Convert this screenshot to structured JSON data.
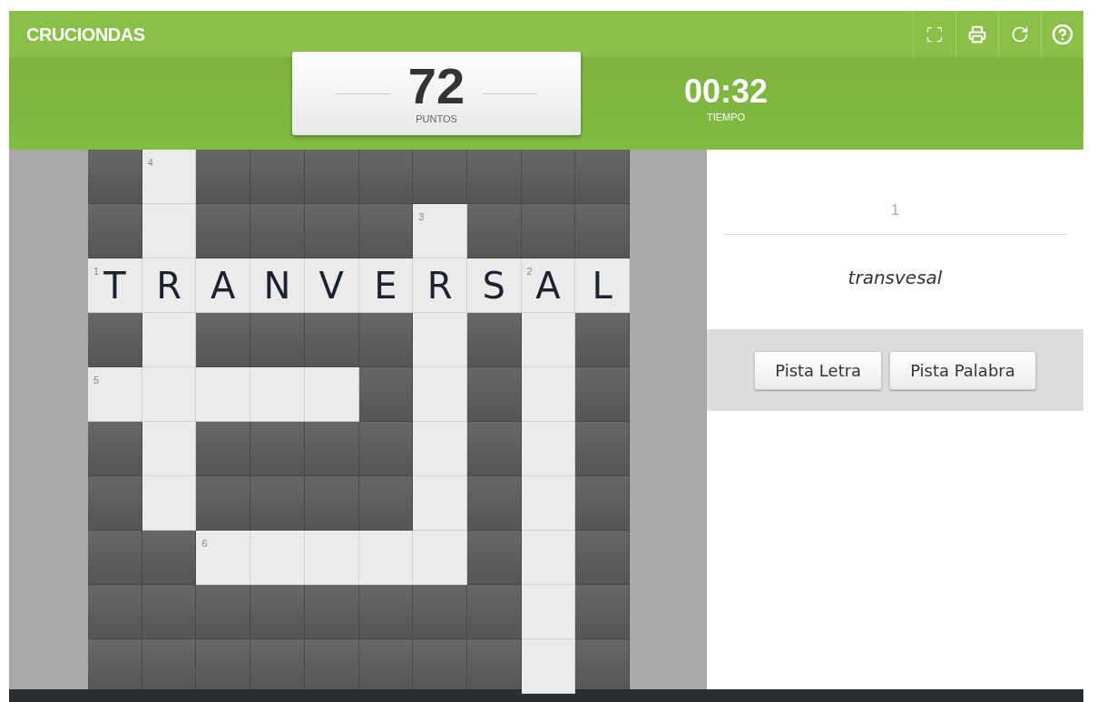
{
  "header": {
    "title": "CRUCIONDAS",
    "tools": [
      {
        "kind": "fullscreen"
      },
      {
        "kind": "print"
      },
      {
        "kind": "restart"
      },
      {
        "kind": "help"
      }
    ]
  },
  "score": {
    "value": "72",
    "label": "PUNTOS"
  },
  "timer": {
    "value": "00:32",
    "label": "TIEMPO"
  },
  "grid": [
    [
      {
        "kind": "block"
      },
      {
        "kind": "open",
        "number": "4"
      },
      {
        "kind": "block"
      },
      {
        "kind": "block"
      },
      {
        "kind": "block"
      },
      {
        "kind": "block"
      },
      {
        "kind": "block"
      },
      {
        "kind": "block"
      },
      {
        "kind": "block"
      },
      {
        "kind": "block"
      }
    ],
    [
      {
        "kind": "block"
      },
      {
        "kind": "open"
      },
      {
        "kind": "block"
      },
      {
        "kind": "block"
      },
      {
        "kind": "block"
      },
      {
        "kind": "block"
      },
      {
        "kind": "open",
        "number": "3"
      },
      {
        "kind": "block"
      },
      {
        "kind": "block"
      },
      {
        "kind": "block"
      }
    ],
    [
      {
        "kind": "open",
        "number": "1",
        "letter": "T"
      },
      {
        "kind": "open",
        "letter": "R"
      },
      {
        "kind": "open",
        "letter": "A"
      },
      {
        "kind": "open",
        "letter": "N"
      },
      {
        "kind": "open",
        "letter": "V"
      },
      {
        "kind": "open",
        "letter": "E"
      },
      {
        "kind": "open",
        "letter": "R"
      },
      {
        "kind": "open",
        "letter": "S"
      },
      {
        "kind": "open",
        "number": "2",
        "letter": "A"
      },
      {
        "kind": "open",
        "letter": "L"
      }
    ],
    [
      {
        "kind": "block"
      },
      {
        "kind": "open"
      },
      {
        "kind": "block"
      },
      {
        "kind": "block"
      },
      {
        "kind": "block"
      },
      {
        "kind": "block"
      },
      {
        "kind": "open"
      },
      {
        "kind": "block"
      },
      {
        "kind": "open"
      },
      {
        "kind": "block"
      }
    ],
    [
      {
        "kind": "open",
        "number": "5"
      },
      {
        "kind": "open"
      },
      {
        "kind": "open"
      },
      {
        "kind": "open"
      },
      {
        "kind": "open"
      },
      {
        "kind": "block"
      },
      {
        "kind": "open"
      },
      {
        "kind": "block"
      },
      {
        "kind": "open"
      },
      {
        "kind": "block"
      }
    ],
    [
      {
        "kind": "block"
      },
      {
        "kind": "open"
      },
      {
        "kind": "block"
      },
      {
        "kind": "block"
      },
      {
        "kind": "block"
      },
      {
        "kind": "block"
      },
      {
        "kind": "open"
      },
      {
        "kind": "block"
      },
      {
        "kind": "open"
      },
      {
        "kind": "block"
      }
    ],
    [
      {
        "kind": "block"
      },
      {
        "kind": "open"
      },
      {
        "kind": "block"
      },
      {
        "kind": "block"
      },
      {
        "kind": "block"
      },
      {
        "kind": "block"
      },
      {
        "kind": "open"
      },
      {
        "kind": "block"
      },
      {
        "kind": "open"
      },
      {
        "kind": "block"
      }
    ],
    [
      {
        "kind": "block"
      },
      {
        "kind": "block"
      },
      {
        "kind": "open",
        "number": "6"
      },
      {
        "kind": "open"
      },
      {
        "kind": "open"
      },
      {
        "kind": "open"
      },
      {
        "kind": "open"
      },
      {
        "kind": "block"
      },
      {
        "kind": "open"
      },
      {
        "kind": "block"
      }
    ],
    [
      {
        "kind": "block"
      },
      {
        "kind": "block"
      },
      {
        "kind": "block"
      },
      {
        "kind": "block"
      },
      {
        "kind": "block"
      },
      {
        "kind": "block"
      },
      {
        "kind": "block"
      },
      {
        "kind": "block"
      },
      {
        "kind": "open"
      },
      {
        "kind": "block"
      }
    ],
    [
      {
        "kind": "block"
      },
      {
        "kind": "block"
      },
      {
        "kind": "block"
      },
      {
        "kind": "block"
      },
      {
        "kind": "block"
      },
      {
        "kind": "block"
      },
      {
        "kind": "block"
      },
      {
        "kind": "block"
      },
      {
        "kind": "open"
      },
      {
        "kind": "block"
      }
    ]
  ],
  "clue": {
    "number": "1",
    "text": "transvesal"
  },
  "hints": [
    "Pista Letra",
    "Pista Palabra"
  ]
}
